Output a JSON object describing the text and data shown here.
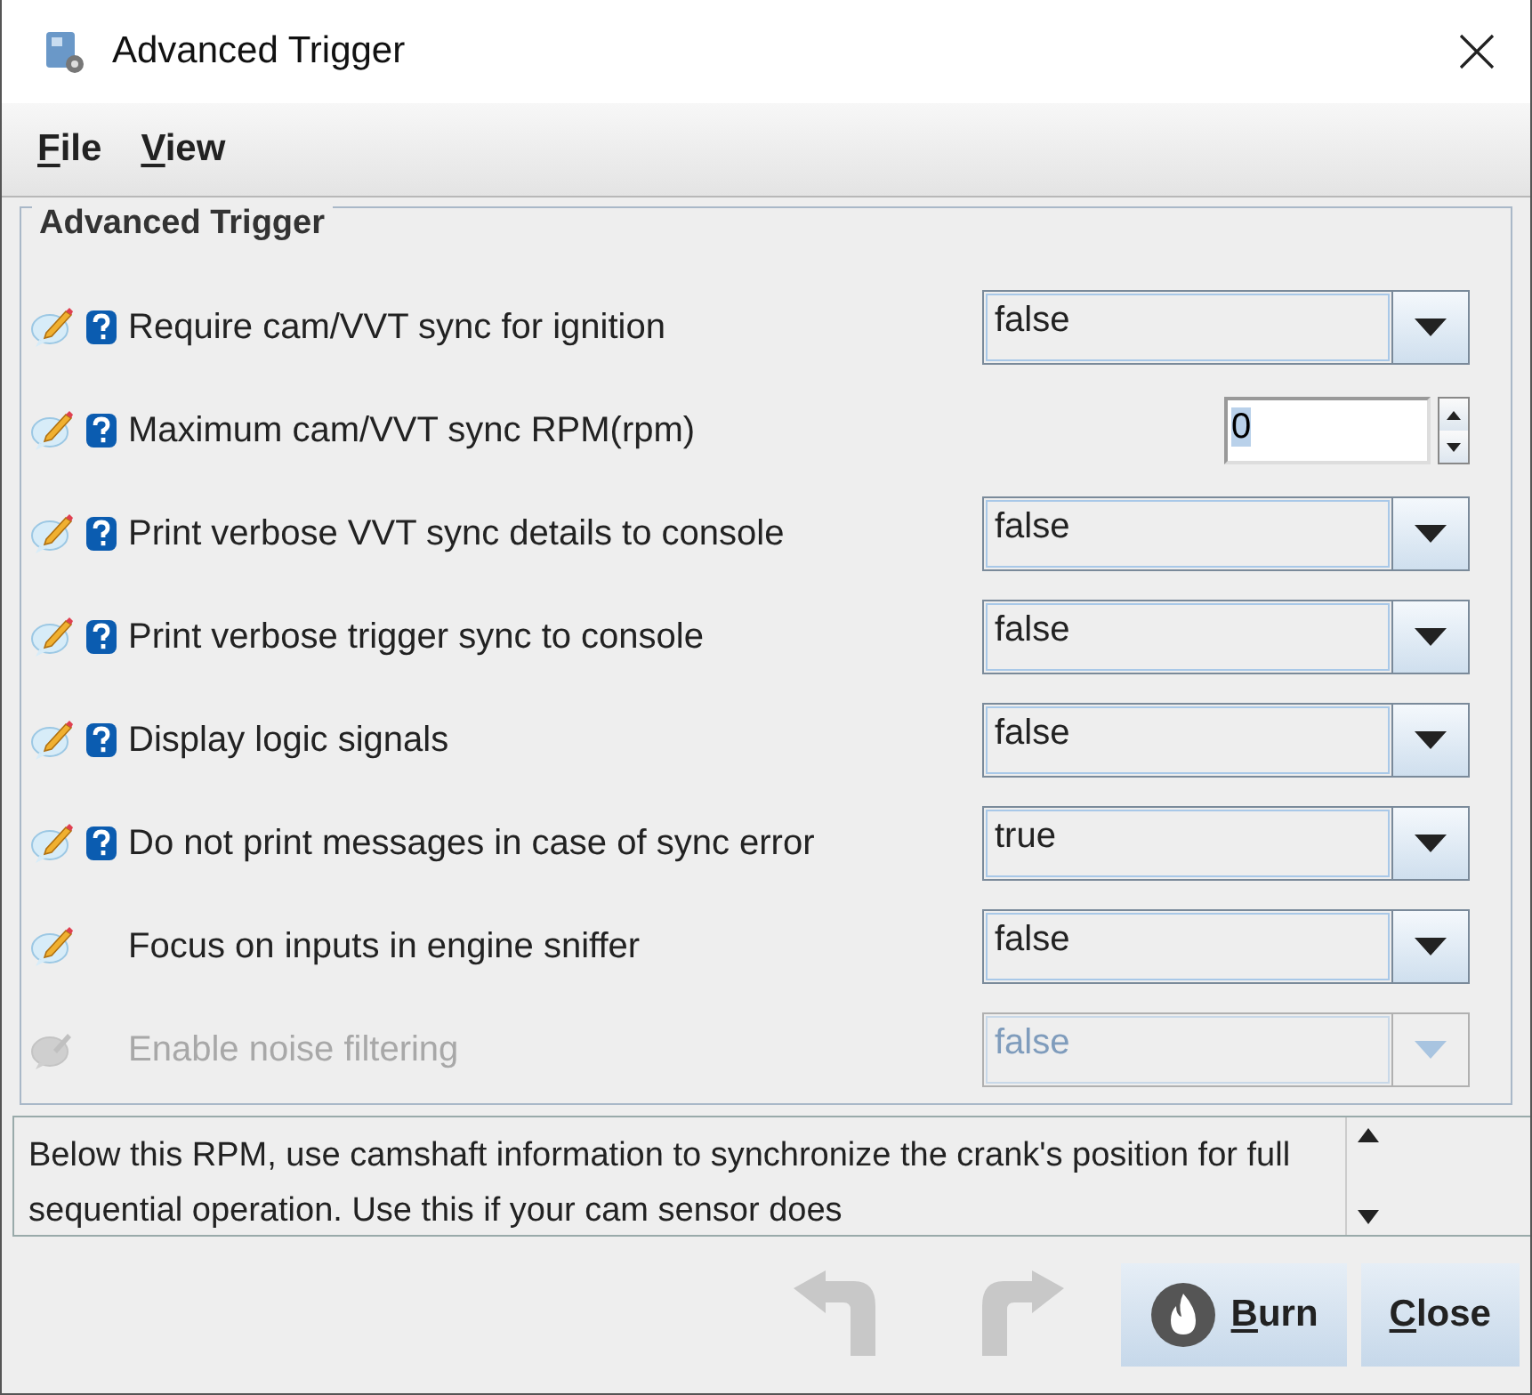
{
  "window": {
    "title": "Advanced Trigger"
  },
  "menu": [
    {
      "mnemonic": "F",
      "rest": "ile"
    },
    {
      "mnemonic": "V",
      "rest": "iew"
    }
  ],
  "group": {
    "title": "Advanced Trigger",
    "rows": [
      {
        "label": "Require cam/VVT sync for ignition",
        "help": true,
        "disabled": false,
        "kind": "combo",
        "value": "false"
      },
      {
        "label": "Maximum cam/VVT sync RPM(rpm)",
        "help": true,
        "disabled": false,
        "kind": "spinner",
        "value": "0"
      },
      {
        "label": "Print verbose VVT sync details to console",
        "help": true,
        "disabled": false,
        "kind": "combo",
        "value": "false"
      },
      {
        "label": "Print verbose trigger sync to console",
        "help": true,
        "disabled": false,
        "kind": "combo",
        "value": "false"
      },
      {
        "label": "Display logic signals",
        "help": true,
        "disabled": false,
        "kind": "combo",
        "value": "false"
      },
      {
        "label": "Do not print messages in case of sync error",
        "help": true,
        "disabled": false,
        "kind": "combo",
        "value": "true"
      },
      {
        "label": "Focus on inputs in engine sniffer",
        "help": false,
        "disabled": false,
        "kind": "combo",
        "value": "false"
      },
      {
        "label": "Enable noise filtering",
        "help": false,
        "disabled": true,
        "kind": "combo",
        "value": "false"
      }
    ]
  },
  "description": "Below this RPM, use camshaft information to synchronize the crank's position for full sequential operation. Use this if your cam sensor does",
  "buttons": [
    {
      "kind": "undo",
      "disabled": true
    },
    {
      "kind": "redo",
      "disabled": true
    },
    {
      "kind": "burn",
      "mnemonic": "B",
      "rest": "urn"
    },
    {
      "kind": "close",
      "mnemonic": "C",
      "rest": "lose"
    }
  ]
}
